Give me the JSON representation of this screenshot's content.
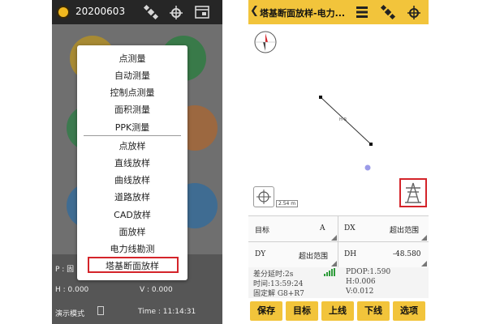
{
  "left_app": {
    "project_title": "20200603",
    "menu_items": [
      "点测量",
      "自动测量",
      "控制点测量",
      "面积测量",
      "PPK测量",
      "点放样",
      "直线放样",
      "曲线放样",
      "道路放样",
      "CAD放样",
      "面放样",
      "电力线勘测",
      "塔基断面放样"
    ],
    "status": {
      "p_label": "P : 固",
      "h_value": "H : 0.000",
      "v_value": "V : 0.000",
      "mode": "演示模式",
      "time": "Time : 11:14:31"
    },
    "colors": {
      "circle_top": "#e2b42c",
      "circle_mid_left": "#3aa05c",
      "circle_mid_right": "#d9753a",
      "circle_bottom": "#3a86c8"
    }
  },
  "right_app": {
    "title": "塔基断面放样-电力...",
    "line_label": "H-R",
    "scale_label": "2.54 m",
    "grid": {
      "target_label": "目标",
      "target_value": "A",
      "dx_label": "DX",
      "dx_value": "超出范围",
      "dy_label": "DY",
      "dy_value": "超出范围",
      "dh_label": "DH",
      "dh_value": "-48.580"
    },
    "info": {
      "delay": "差分延时:2s",
      "pdop": "PDOP:1.590",
      "time": "时间:13:59:24",
      "h": "H:0.006",
      "fix": "固定解 G8+R7",
      "v": "V:0.012"
    },
    "buttons": [
      "保存",
      "目标",
      "上线",
      "下线",
      "选项"
    ]
  }
}
